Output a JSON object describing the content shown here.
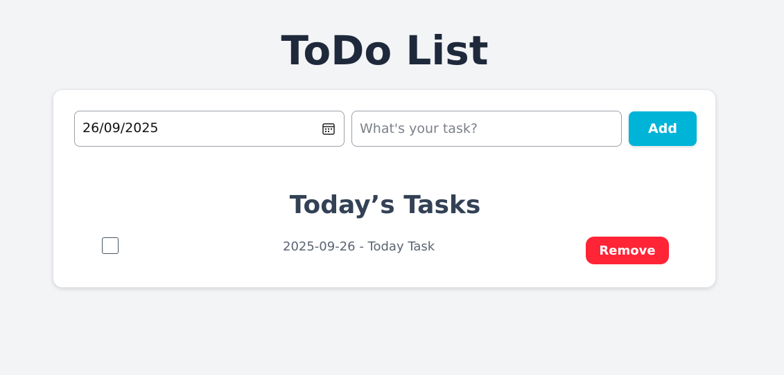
{
  "app": {
    "title": "ToDo List"
  },
  "form": {
    "date_value": "26/09/2025",
    "task_placeholder": "What's your task?",
    "task_value": "",
    "add_label": "Add"
  },
  "tasks_section": {
    "heading": "Today’s Tasks",
    "items": [
      {
        "text": "2025-09-26 - Today Task",
        "checked": false,
        "remove_label": "Remove"
      }
    ]
  },
  "colors": {
    "background": "#f3f4f6",
    "add_button": "#00b4d8",
    "remove_button": "#ff2436",
    "title": "#1e293b"
  },
  "icons": {
    "date_picker": "calendar-icon"
  }
}
